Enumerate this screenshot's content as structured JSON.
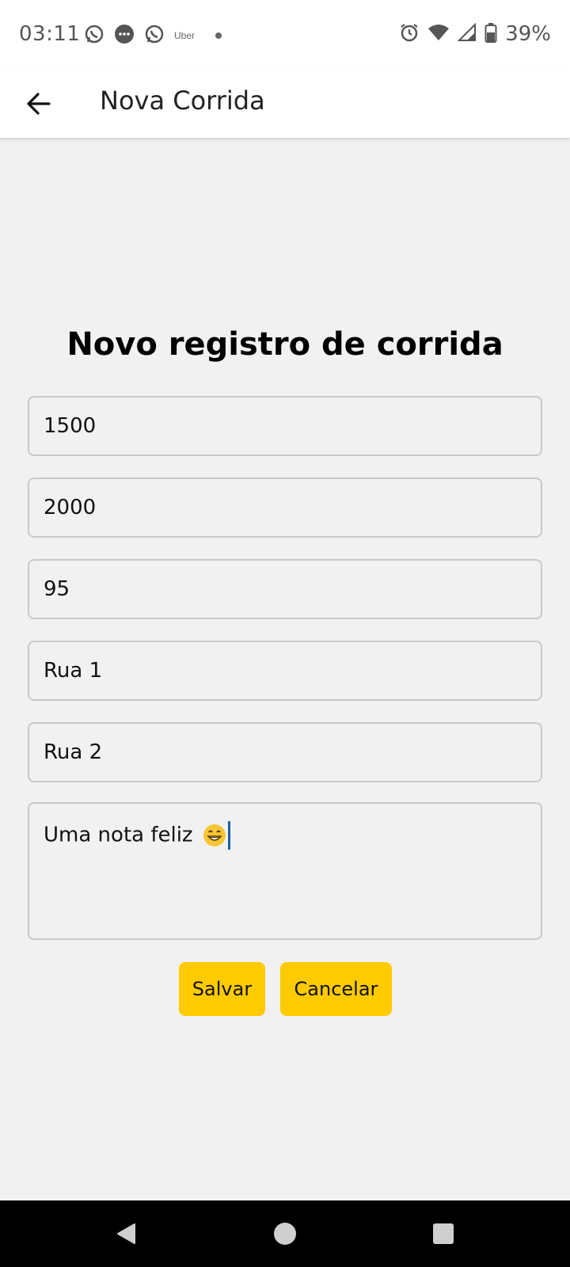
{
  "status_bar": {
    "time": "03:11",
    "uber_label": "Uber",
    "battery_percent": "39%",
    "icons": [
      "whatsapp-icon",
      "message-icon",
      "whatsapp-icon",
      "uber-icon",
      "dot-icon",
      "alarm-icon",
      "wifi-icon",
      "signal-icon",
      "battery-icon"
    ]
  },
  "app_bar": {
    "title": "Nova Corrida"
  },
  "form": {
    "heading": "Novo registro de corrida",
    "fields": [
      {
        "value": "1500"
      },
      {
        "value": "2000"
      },
      {
        "value": "95"
      },
      {
        "value": "Rua 1"
      },
      {
        "value": "Rua 2"
      }
    ],
    "note": {
      "value": "Uma nota feliz"
    },
    "save_label": "Salvar",
    "cancel_label": "Cancelar"
  },
  "colors": {
    "accent": "#fecb00",
    "background": "#f1f1f1",
    "cursor": "#1b5fa8"
  }
}
